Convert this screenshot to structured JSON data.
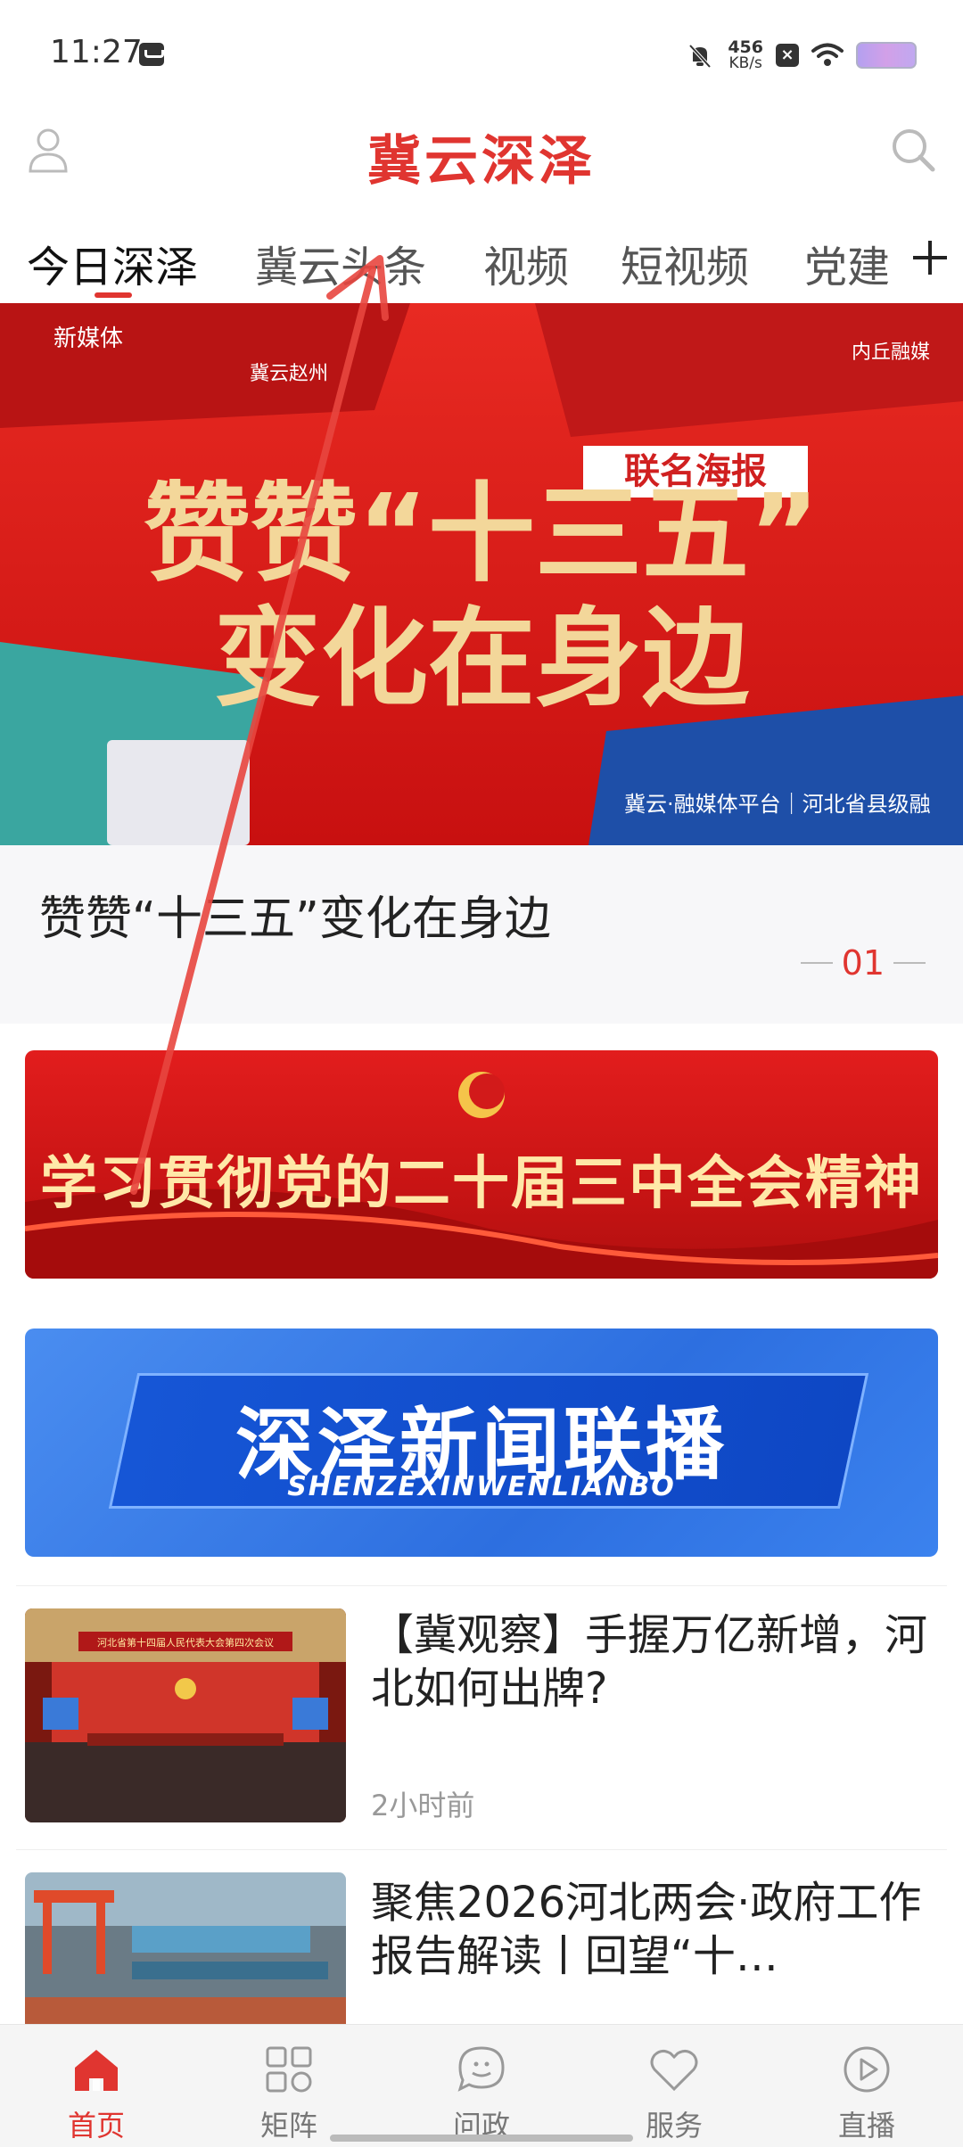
{
  "status_bar": {
    "time": "11:27",
    "speed_value": "456",
    "speed_unit": "KB/s",
    "x_label": "×"
  },
  "header": {
    "title": "冀云深泽",
    "user_icon": "user-icon",
    "search_icon": "search-icon"
  },
  "tabs": [
    {
      "label": "今日深泽",
      "active": true
    },
    {
      "label": "冀云头条",
      "active": false
    },
    {
      "label": "视频",
      "active": false
    },
    {
      "label": "短视频",
      "active": false
    },
    {
      "label": "党建",
      "active": false
    }
  ],
  "hero": {
    "poster_tag": "联名海报",
    "poster_line1": "赞赞“十三五”",
    "poster_line2": "变化在身边",
    "poster_media": "新媒体",
    "poster_county": "冀云赵州",
    "poster_footer": "冀云·融媒体平台｜河北省县级融",
    "poster_corner": "内丘融媒",
    "caption": "赞赞“十三五”变化在身边",
    "page_indicator": "01"
  },
  "banners": {
    "party": "学习贯彻党的二十届三中全会精神",
    "news_title": "深泽新闻联播",
    "news_subtitle": "SHENZEXINWENLIANBO"
  },
  "news": [
    {
      "title": "【冀观察】手握万亿新增，河北如何出牌?",
      "time": "2小时前",
      "thumb_caption": "河北省第十四届人民代表大会第四次会议"
    },
    {
      "title": "聚焦2026河北两会·政府工作报告解读丨回望“十…",
      "time": ""
    }
  ],
  "bottom_nav": [
    {
      "label": "首页",
      "icon": "home-icon",
      "active": true
    },
    {
      "label": "矩阵",
      "icon": "grid-icon",
      "active": false
    },
    {
      "label": "问政",
      "icon": "chat-icon",
      "active": false
    },
    {
      "label": "服务",
      "icon": "heart-icon",
      "active": false
    },
    {
      "label": "直播",
      "icon": "play-icon",
      "active": false
    }
  ],
  "colors": {
    "brand_red": "#e03530",
    "banner_blue": "#2d6fe0",
    "gold_text": "#ffe8a8"
  }
}
